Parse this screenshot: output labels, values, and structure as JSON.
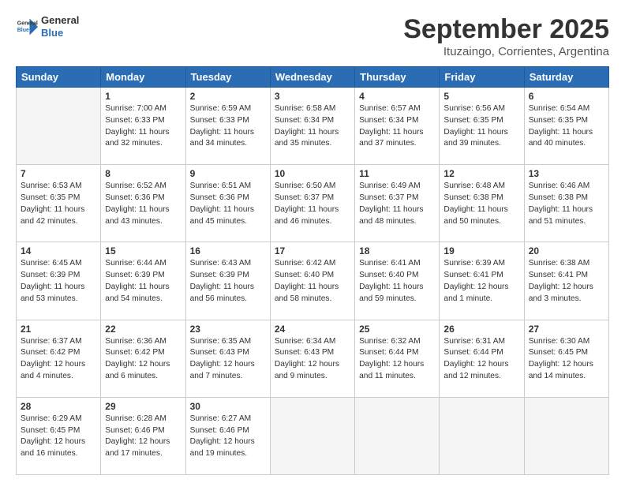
{
  "logo": {
    "line1": "General",
    "line2": "Blue"
  },
  "title": "September 2025",
  "subtitle": "Ituzaingo, Corrientes, Argentina",
  "days": [
    "Sunday",
    "Monday",
    "Tuesday",
    "Wednesday",
    "Thursday",
    "Friday",
    "Saturday"
  ],
  "weeks": [
    [
      {
        "num": "",
        "info": ""
      },
      {
        "num": "1",
        "info": "Sunrise: 7:00 AM\nSunset: 6:33 PM\nDaylight: 11 hours\nand 32 minutes."
      },
      {
        "num": "2",
        "info": "Sunrise: 6:59 AM\nSunset: 6:33 PM\nDaylight: 11 hours\nand 34 minutes."
      },
      {
        "num": "3",
        "info": "Sunrise: 6:58 AM\nSunset: 6:34 PM\nDaylight: 11 hours\nand 35 minutes."
      },
      {
        "num": "4",
        "info": "Sunrise: 6:57 AM\nSunset: 6:34 PM\nDaylight: 11 hours\nand 37 minutes."
      },
      {
        "num": "5",
        "info": "Sunrise: 6:56 AM\nSunset: 6:35 PM\nDaylight: 11 hours\nand 39 minutes."
      },
      {
        "num": "6",
        "info": "Sunrise: 6:54 AM\nSunset: 6:35 PM\nDaylight: 11 hours\nand 40 minutes."
      }
    ],
    [
      {
        "num": "7",
        "info": "Sunrise: 6:53 AM\nSunset: 6:35 PM\nDaylight: 11 hours\nand 42 minutes."
      },
      {
        "num": "8",
        "info": "Sunrise: 6:52 AM\nSunset: 6:36 PM\nDaylight: 11 hours\nand 43 minutes."
      },
      {
        "num": "9",
        "info": "Sunrise: 6:51 AM\nSunset: 6:36 PM\nDaylight: 11 hours\nand 45 minutes."
      },
      {
        "num": "10",
        "info": "Sunrise: 6:50 AM\nSunset: 6:37 PM\nDaylight: 11 hours\nand 46 minutes."
      },
      {
        "num": "11",
        "info": "Sunrise: 6:49 AM\nSunset: 6:37 PM\nDaylight: 11 hours\nand 48 minutes."
      },
      {
        "num": "12",
        "info": "Sunrise: 6:48 AM\nSunset: 6:38 PM\nDaylight: 11 hours\nand 50 minutes."
      },
      {
        "num": "13",
        "info": "Sunrise: 6:46 AM\nSunset: 6:38 PM\nDaylight: 11 hours\nand 51 minutes."
      }
    ],
    [
      {
        "num": "14",
        "info": "Sunrise: 6:45 AM\nSunset: 6:39 PM\nDaylight: 11 hours\nand 53 minutes."
      },
      {
        "num": "15",
        "info": "Sunrise: 6:44 AM\nSunset: 6:39 PM\nDaylight: 11 hours\nand 54 minutes."
      },
      {
        "num": "16",
        "info": "Sunrise: 6:43 AM\nSunset: 6:39 PM\nDaylight: 11 hours\nand 56 minutes."
      },
      {
        "num": "17",
        "info": "Sunrise: 6:42 AM\nSunset: 6:40 PM\nDaylight: 11 hours\nand 58 minutes."
      },
      {
        "num": "18",
        "info": "Sunrise: 6:41 AM\nSunset: 6:40 PM\nDaylight: 11 hours\nand 59 minutes."
      },
      {
        "num": "19",
        "info": "Sunrise: 6:39 AM\nSunset: 6:41 PM\nDaylight: 12 hours\nand 1 minute."
      },
      {
        "num": "20",
        "info": "Sunrise: 6:38 AM\nSunset: 6:41 PM\nDaylight: 12 hours\nand 3 minutes."
      }
    ],
    [
      {
        "num": "21",
        "info": "Sunrise: 6:37 AM\nSunset: 6:42 PM\nDaylight: 12 hours\nand 4 minutes."
      },
      {
        "num": "22",
        "info": "Sunrise: 6:36 AM\nSunset: 6:42 PM\nDaylight: 12 hours\nand 6 minutes."
      },
      {
        "num": "23",
        "info": "Sunrise: 6:35 AM\nSunset: 6:43 PM\nDaylight: 12 hours\nand 7 minutes."
      },
      {
        "num": "24",
        "info": "Sunrise: 6:34 AM\nSunset: 6:43 PM\nDaylight: 12 hours\nand 9 minutes."
      },
      {
        "num": "25",
        "info": "Sunrise: 6:32 AM\nSunset: 6:44 PM\nDaylight: 12 hours\nand 11 minutes."
      },
      {
        "num": "26",
        "info": "Sunrise: 6:31 AM\nSunset: 6:44 PM\nDaylight: 12 hours\nand 12 minutes."
      },
      {
        "num": "27",
        "info": "Sunrise: 6:30 AM\nSunset: 6:45 PM\nDaylight: 12 hours\nand 14 minutes."
      }
    ],
    [
      {
        "num": "28",
        "info": "Sunrise: 6:29 AM\nSunset: 6:45 PM\nDaylight: 12 hours\nand 16 minutes."
      },
      {
        "num": "29",
        "info": "Sunrise: 6:28 AM\nSunset: 6:46 PM\nDaylight: 12 hours\nand 17 minutes."
      },
      {
        "num": "30",
        "info": "Sunrise: 6:27 AM\nSunset: 6:46 PM\nDaylight: 12 hours\nand 19 minutes."
      },
      {
        "num": "",
        "info": ""
      },
      {
        "num": "",
        "info": ""
      },
      {
        "num": "",
        "info": ""
      },
      {
        "num": "",
        "info": ""
      }
    ]
  ]
}
